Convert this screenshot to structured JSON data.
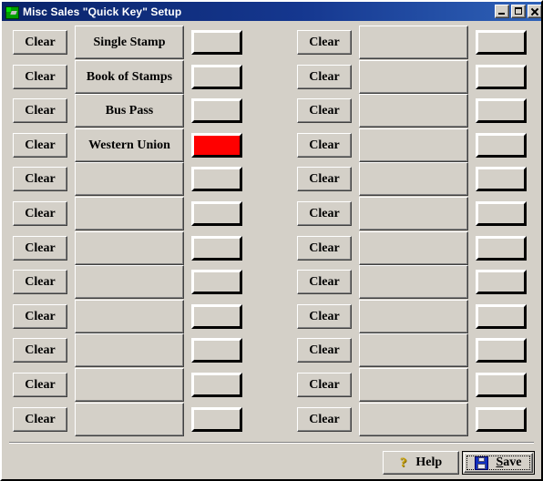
{
  "window": {
    "title": "Misc Sales \"Quick Key\" Setup",
    "icon": "app-icon",
    "controls": {
      "minimize": "minimize-icon",
      "maximize": "maximize-icon",
      "close": "close-icon"
    }
  },
  "colors": {
    "face": "#d4d0c8",
    "title_start": "#0a246a",
    "title_end": "#2f62b8",
    "assigned_swatch": "#FF0000",
    "empty_swatch": "#d4d0c8",
    "help_icon": "#c8a000",
    "save_icon": "#1030c0"
  },
  "grid": {
    "clear_label": "Clear",
    "rows": 12,
    "columns": [
      {
        "side": "left",
        "items": [
          {
            "clear": "Clear",
            "label": "Single Stamp",
            "color": "#d4d0c8"
          },
          {
            "clear": "Clear",
            "label": "Book of Stamps",
            "color": "#d4d0c8"
          },
          {
            "clear": "Clear",
            "label": "Bus Pass",
            "color": "#d4d0c8"
          },
          {
            "clear": "Clear",
            "label": "Western Union",
            "color": "#FF0000"
          },
          {
            "clear": "Clear",
            "label": "",
            "color": "#d4d0c8"
          },
          {
            "clear": "Clear",
            "label": "",
            "color": "#d4d0c8"
          },
          {
            "clear": "Clear",
            "label": "",
            "color": "#d4d0c8"
          },
          {
            "clear": "Clear",
            "label": "",
            "color": "#d4d0c8"
          },
          {
            "clear": "Clear",
            "label": "",
            "color": "#d4d0c8"
          },
          {
            "clear": "Clear",
            "label": "",
            "color": "#d4d0c8"
          },
          {
            "clear": "Clear",
            "label": "",
            "color": "#d4d0c8"
          },
          {
            "clear": "Clear",
            "label": "",
            "color": "#d4d0c8"
          }
        ]
      },
      {
        "side": "right",
        "items": [
          {
            "clear": "Clear",
            "label": "",
            "color": "#d4d0c8"
          },
          {
            "clear": "Clear",
            "label": "",
            "color": "#d4d0c8"
          },
          {
            "clear": "Clear",
            "label": "",
            "color": "#d4d0c8"
          },
          {
            "clear": "Clear",
            "label": "",
            "color": "#d4d0c8"
          },
          {
            "clear": "Clear",
            "label": "",
            "color": "#d4d0c8"
          },
          {
            "clear": "Clear",
            "label": "",
            "color": "#d4d0c8"
          },
          {
            "clear": "Clear",
            "label": "",
            "color": "#d4d0c8"
          },
          {
            "clear": "Clear",
            "label": "",
            "color": "#d4d0c8"
          },
          {
            "clear": "Clear",
            "label": "",
            "color": "#d4d0c8"
          },
          {
            "clear": "Clear",
            "label": "",
            "color": "#d4d0c8"
          },
          {
            "clear": "Clear",
            "label": "",
            "color": "#d4d0c8"
          },
          {
            "clear": "Clear",
            "label": "",
            "color": "#d4d0c8"
          }
        ]
      }
    ]
  },
  "footer": {
    "help": {
      "label": "Help",
      "icon": "question-mark-icon"
    },
    "save": {
      "label": "Save",
      "accel": "S",
      "icon": "floppy-disk-icon",
      "is_default": true
    }
  }
}
